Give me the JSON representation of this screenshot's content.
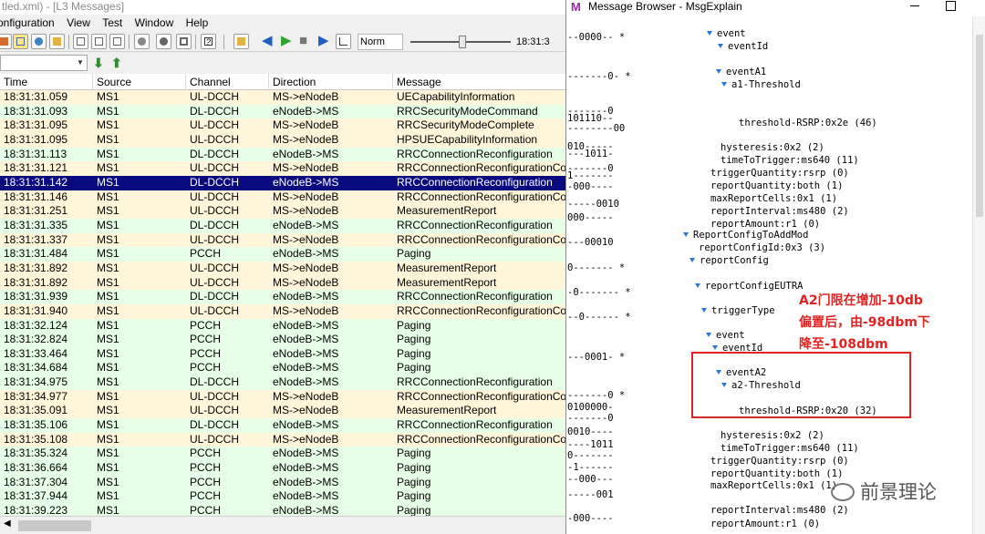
{
  "left_window": {
    "title": "tled.xml) - [L3 Messages]",
    "menu": [
      "onfiguration",
      "View",
      "Test",
      "Window",
      "Help"
    ],
    "zoom": "Norm",
    "time": "18:31:3",
    "columns": [
      "Time",
      "Source",
      "Channel",
      "Direction",
      "Message"
    ],
    "rows": [
      {
        "time": "18:31:31.059",
        "source": "MS1",
        "channel": "UL-DCCH",
        "direction": "MS->eNodeB",
        "message": "UECapabilityInformation",
        "type": "up"
      },
      {
        "time": "18:31:31.093",
        "source": "MS1",
        "channel": "DL-DCCH",
        "direction": "eNodeB->MS",
        "message": "RRCSecurityModeCommand",
        "type": "dl"
      },
      {
        "time": "18:31:31.095",
        "source": "MS1",
        "channel": "UL-DCCH",
        "direction": "MS->eNodeB",
        "message": "RRCSecurityModeComplete",
        "type": "up"
      },
      {
        "time": "18:31:31.095",
        "source": "MS1",
        "channel": "UL-DCCH",
        "direction": "MS->eNodeB",
        "message": "HPSUECapabilityInformation",
        "type": "up"
      },
      {
        "time": "18:31:31.113",
        "source": "MS1",
        "channel": "DL-DCCH",
        "direction": "eNodeB->MS",
        "message": "RRCConnectionReconfiguration",
        "type": "dl"
      },
      {
        "time": "18:31:31.121",
        "source": "MS1",
        "channel": "UL-DCCH",
        "direction": "MS->eNodeB",
        "message": "RRCConnectionReconfigurationCo",
        "type": "up"
      },
      {
        "time": "18:31:31.142",
        "source": "MS1",
        "channel": "DL-DCCH",
        "direction": "eNodeB->MS",
        "message": "RRCConnectionReconfiguration",
        "type": "sel"
      },
      {
        "time": "18:31:31.146",
        "source": "MS1",
        "channel": "UL-DCCH",
        "direction": "MS->eNodeB",
        "message": "RRCConnectionReconfigurationCo",
        "type": "up"
      },
      {
        "time": "18:31:31.251",
        "source": "MS1",
        "channel": "UL-DCCH",
        "direction": "MS->eNodeB",
        "message": "MeasurementReport",
        "type": "up"
      },
      {
        "time": "18:31:31.335",
        "source": "MS1",
        "channel": "DL-DCCH",
        "direction": "eNodeB->MS",
        "message": "RRCConnectionReconfiguration",
        "type": "dl"
      },
      {
        "time": "18:31:31.337",
        "source": "MS1",
        "channel": "UL-DCCH",
        "direction": "MS->eNodeB",
        "message": "RRCConnectionReconfigurationCo",
        "type": "up"
      },
      {
        "time": "18:31:31.484",
        "source": "MS1",
        "channel": "PCCH",
        "direction": "eNodeB->MS",
        "message": "Paging",
        "type": "dl"
      },
      {
        "time": "18:31:31.892",
        "source": "MS1",
        "channel": "UL-DCCH",
        "direction": "MS->eNodeB",
        "message": "MeasurementReport",
        "type": "up"
      },
      {
        "time": "18:31:31.892",
        "source": "MS1",
        "channel": "UL-DCCH",
        "direction": "MS->eNodeB",
        "message": "MeasurementReport",
        "type": "up"
      },
      {
        "time": "18:31:31.939",
        "source": "MS1",
        "channel": "DL-DCCH",
        "direction": "eNodeB->MS",
        "message": "RRCConnectionReconfiguration",
        "type": "dl"
      },
      {
        "time": "18:31:31.940",
        "source": "MS1",
        "channel": "UL-DCCH",
        "direction": "MS->eNodeB",
        "message": "RRCConnectionReconfigurationCo",
        "type": "up"
      },
      {
        "time": "18:31:32.124",
        "source": "MS1",
        "channel": "PCCH",
        "direction": "eNodeB->MS",
        "message": "Paging",
        "type": "dl"
      },
      {
        "time": "18:31:32.824",
        "source": "MS1",
        "channel": "PCCH",
        "direction": "eNodeB->MS",
        "message": "Paging",
        "type": "dl"
      },
      {
        "time": "18:31:33.464",
        "source": "MS1",
        "channel": "PCCH",
        "direction": "eNodeB->MS",
        "message": "Paging",
        "type": "dl"
      },
      {
        "time": "18:31:34.684",
        "source": "MS1",
        "channel": "PCCH",
        "direction": "eNodeB->MS",
        "message": "Paging",
        "type": "dl"
      },
      {
        "time": "18:31:34.975",
        "source": "MS1",
        "channel": "DL-DCCH",
        "direction": "eNodeB->MS",
        "message": "RRCConnectionReconfiguration",
        "type": "dl"
      },
      {
        "time": "18:31:34.977",
        "source": "MS1",
        "channel": "UL-DCCH",
        "direction": "MS->eNodeB",
        "message": "RRCConnectionReconfigurationCo",
        "type": "up"
      },
      {
        "time": "18:31:35.091",
        "source": "MS1",
        "channel": "UL-DCCH",
        "direction": "MS->eNodeB",
        "message": "MeasurementReport",
        "type": "up"
      },
      {
        "time": "18:31:35.106",
        "source": "MS1",
        "channel": "DL-DCCH",
        "direction": "eNodeB->MS",
        "message": "RRCConnectionReconfiguration",
        "type": "dl"
      },
      {
        "time": "18:31:35.108",
        "source": "MS1",
        "channel": "UL-DCCH",
        "direction": "MS->eNodeB",
        "message": "RRCConnectionReconfigurationCo",
        "type": "up"
      },
      {
        "time": "18:31:35.324",
        "source": "MS1",
        "channel": "PCCH",
        "direction": "eNodeB->MS",
        "message": "Paging",
        "type": "dl"
      },
      {
        "time": "18:31:36.664",
        "source": "MS1",
        "channel": "PCCH",
        "direction": "eNodeB->MS",
        "message": "Paging",
        "type": "dl"
      },
      {
        "time": "18:31:37.304",
        "source": "MS1",
        "channel": "PCCH",
        "direction": "eNodeB->MS",
        "message": "Paging",
        "type": "dl"
      },
      {
        "time": "18:31:37.944",
        "source": "MS1",
        "channel": "PCCH",
        "direction": "eNodeB->MS",
        "message": "Paging",
        "type": "dl"
      },
      {
        "time": "18:31:39.223",
        "source": "MS1",
        "channel": "PCCH",
        "direction": "eNodeB->MS",
        "message": "Paging",
        "type": "dl"
      }
    ]
  },
  "right_window": {
    "title": "Message Browser - MsgExplain",
    "bits": [
      "--0000-- *",
      "-------0- *",
      "-------0",
      "101110--",
      "--------00",
      "010-----",
      "---1011-",
      "-------0",
      "1-------",
      "-000----",
      "-----0010",
      "000-----",
      "---00010",
      "0------- *",
      "-0------- *",
      "--0------ *",
      "---0001- *",
      "-------0 *",
      "0100000-",
      "-------0",
      "0010----",
      "----1011",
      "0-------",
      "-1------",
      "--000---",
      "-----001",
      "-000----"
    ],
    "tree": [
      {
        "text": "event",
        "arrow": true
      },
      {
        "text": "eventId",
        "arrow": true
      },
      {
        "text": "eventA1",
        "arrow": true
      },
      {
        "text": "a1-Threshold",
        "arrow": true
      },
      {
        "text": "threshold-RSRP:0x2e (46)",
        "arrow": false
      },
      {
        "text": "hysteresis:0x2 (2)",
        "arrow": false
      },
      {
        "text": "timeToTrigger:ms640 (11)",
        "arrow": false
      },
      {
        "text": "triggerQuantity:rsrp (0)",
        "arrow": false
      },
      {
        "text": "reportQuantity:both (1)",
        "arrow": false
      },
      {
        "text": "maxReportCells:0x1 (1)",
        "arrow": false
      },
      {
        "text": "reportInterval:ms480 (2)",
        "arrow": false
      },
      {
        "text": "reportAmount:r1 (0)",
        "arrow": false
      },
      {
        "text": "ReportConfigToAddMod",
        "arrow": true
      },
      {
        "text": "reportConfigId:0x3 (3)",
        "arrow": false
      },
      {
        "text": "reportConfig",
        "arrow": true
      },
      {
        "text": "reportConfigEUTRA",
        "arrow": true
      },
      {
        "text": "triggerType",
        "arrow": true
      },
      {
        "text": "event",
        "arrow": true
      },
      {
        "text": "eventId",
        "arrow": true
      },
      {
        "text": "eventA2",
        "arrow": true
      },
      {
        "text": "a2-Threshold",
        "arrow": true
      },
      {
        "text": "threshold-RSRP:0x20 (32)",
        "arrow": false
      },
      {
        "text": "hysteresis:0x2 (2)",
        "arrow": false
      },
      {
        "text": "timeToTrigger:ms640 (11)",
        "arrow": false
      },
      {
        "text": "triggerQuantity:rsrp (0)",
        "arrow": false
      },
      {
        "text": "reportQuantity:both (1)",
        "arrow": false
      },
      {
        "text": "maxReportCells:0x1 (1)",
        "arrow": false
      },
      {
        "text": "reportInterval:ms480 (2)",
        "arrow": false
      },
      {
        "text": "reportAmount:r1 (0)",
        "arrow": false
      }
    ],
    "annotation": [
      "A2门限在增加-10db",
      "偏置后，由-98dbm下",
      "降至-108dbm"
    ],
    "watermark": "前景理论"
  }
}
